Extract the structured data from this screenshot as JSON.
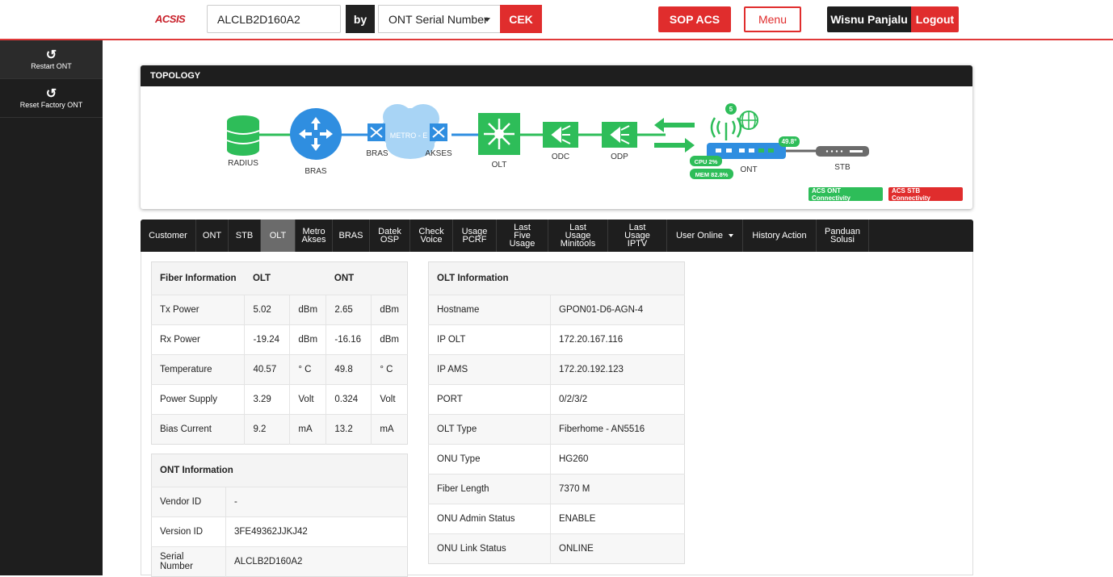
{
  "header": {
    "logo": "ACSIS",
    "search_value": "ALCLB2D160A2",
    "by_label": "by",
    "by_select": "ONT Serial Number",
    "cek_label": "CEK",
    "sop_label": "SOP ACS",
    "menu_label": "Menu",
    "user_name": "Wisnu Panjalu",
    "logout_label": "Logout"
  },
  "sidebar": {
    "items": [
      {
        "label": "Restart ONT",
        "icon": "restart-icon"
      },
      {
        "label": "Reset Factory ONT",
        "icon": "reset-icon"
      }
    ]
  },
  "topology": {
    "title": "TOPOLOGY",
    "nodes": {
      "radius": "RADIUS",
      "bras": "BRAS",
      "bras2": "BRAS",
      "metro": "METRO - E",
      "akses": "AKSES",
      "olt": "OLT",
      "odc": "ODC",
      "odp": "ODP",
      "ont": "ONT",
      "stb": "STB"
    },
    "ont_badges": {
      "clients": "5",
      "temp": "49.8°",
      "cpu": "CPU 2%",
      "mem": "MEM 82.8%"
    },
    "acs_ont": "ACS ONT Connectivity",
    "acs_stb": "ACS STB Connectivity",
    "colors": {
      "green": "#2ebd59",
      "blue": "#2f8ee0",
      "red": "#e02d2d"
    }
  },
  "tabs": [
    {
      "label": "Customer"
    },
    {
      "label": "ONT"
    },
    {
      "label": "STB"
    },
    {
      "label": "OLT",
      "active": true
    },
    {
      "label": "Metro Akses"
    },
    {
      "label": "BRAS"
    },
    {
      "label": "Datek OSP"
    },
    {
      "label": "Check Voice"
    },
    {
      "label": "Usage PCRF"
    },
    {
      "label": "Last Five Usage"
    },
    {
      "label": "Last Usage Minitools"
    },
    {
      "label": "Last Usage IPTV"
    },
    {
      "label": "User Online",
      "dropdown": true
    },
    {
      "label": "History Action"
    },
    {
      "label": "Panduan Solusi"
    }
  ],
  "fiber": {
    "headers": [
      "Fiber Information",
      "OLT",
      "ONT"
    ],
    "rows": [
      {
        "name": "Tx Power",
        "olt": "5.02",
        "olt_unit": "dBm",
        "ont": "2.65",
        "ont_unit": "dBm"
      },
      {
        "name": "Rx Power",
        "olt": "-19.24",
        "olt_unit": "dBm",
        "ont": "-16.16",
        "ont_unit": "dBm"
      },
      {
        "name": "Temperature",
        "olt": "40.57",
        "olt_unit": "° C",
        "ont": "49.8",
        "ont_unit": "° C"
      },
      {
        "name": "Power Supply",
        "olt": "3.29",
        "olt_unit": "Volt",
        "ont": "0.324",
        "ont_unit": "Volt"
      },
      {
        "name": "Bias Current",
        "olt": "9.2",
        "olt_unit": "mA",
        "ont": "13.2",
        "ont_unit": "mA"
      }
    ]
  },
  "ont_info": {
    "header": "ONT Information",
    "rows": [
      {
        "name": "Vendor ID",
        "value": "-"
      },
      {
        "name": "Version ID",
        "value": "3FE49362JJKJ42"
      },
      {
        "name": "Serial Number",
        "value": "ALCLB2D160A2"
      }
    ]
  },
  "olt_info": {
    "header": "OLT Information",
    "rows": [
      {
        "name": "Hostname",
        "value": "GPON01-D6-AGN-4"
      },
      {
        "name": "IP OLT",
        "value": "172.20.167.116"
      },
      {
        "name": "IP AMS",
        "value": "172.20.192.123"
      },
      {
        "name": "PORT",
        "value": "0/2/3/2"
      },
      {
        "name": "OLT Type",
        "value": "Fiberhome - AN5516"
      },
      {
        "name": "ONU Type",
        "value": "HG260"
      },
      {
        "name": "Fiber Length",
        "value": "7370 M"
      },
      {
        "name": "ONU Admin Status",
        "value": "ENABLE"
      },
      {
        "name": "ONU Link Status",
        "value": "ONLINE"
      }
    ]
  }
}
